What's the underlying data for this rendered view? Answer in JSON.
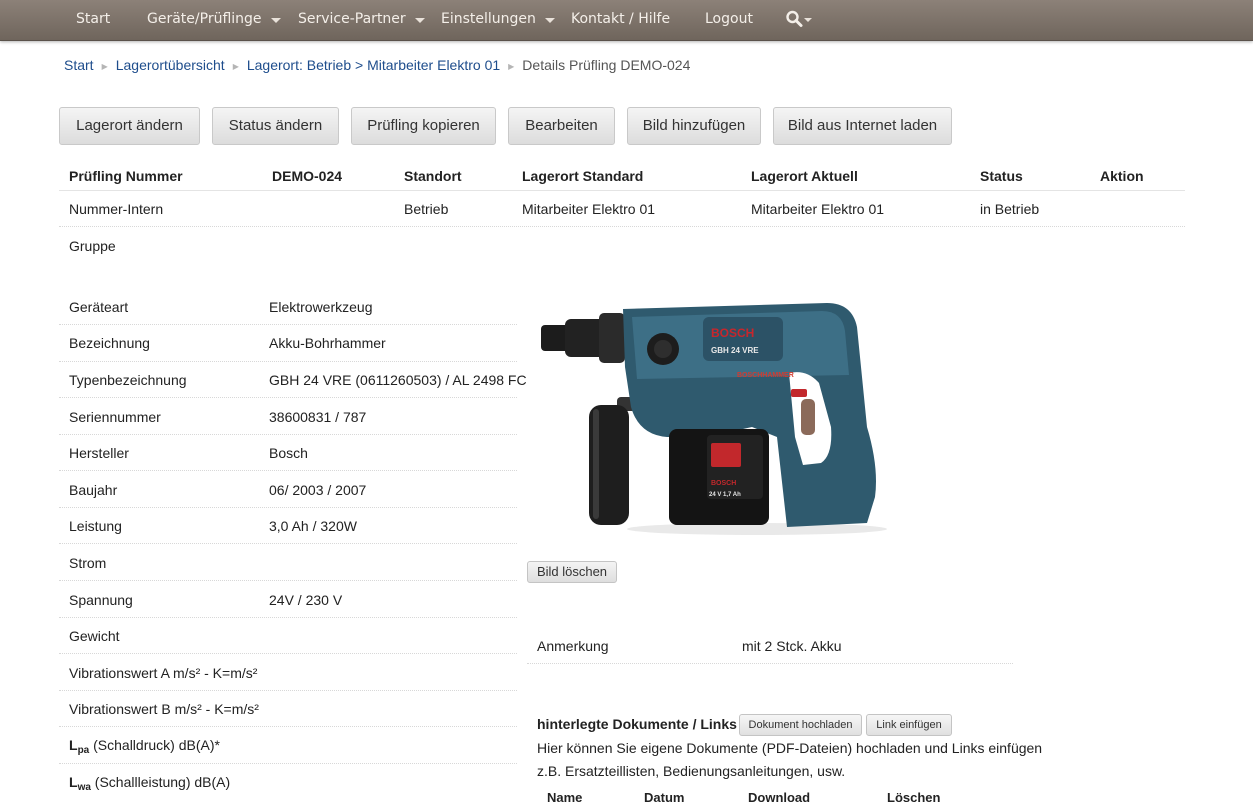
{
  "nav": {
    "start": "Start",
    "geraete": "Geräte/Prüflinge",
    "service": "Service-Partner",
    "einstellungen": "Einstellungen",
    "kontakt": "Kontakt / Hilfe",
    "logout": "Logout",
    "search_icon": "search-icon",
    "colors": {
      "bar": "#7d736a",
      "text": "#f4efe9"
    }
  },
  "breadcrumb": {
    "items": [
      "Start",
      "Lagerortübersicht",
      "Lagerort: Betrieb > Mitarbeiter Elektro 01"
    ],
    "current": "Details Prüfling DEMO-024"
  },
  "actions": {
    "lagerort": "Lagerort ändern",
    "status": "Status ändern",
    "kopieren": "Prüfling kopieren",
    "bearbeiten": "Bearbeiten",
    "bild_hinzu": "Bild hinzufügen",
    "bild_internet": "Bild aus Internet laden"
  },
  "summary": {
    "headers": {
      "nummer": "Prüfling Nummer",
      "nummer_value": "DEMO-024",
      "standort": "Standort",
      "lagerort_standard": "Lagerort Standard",
      "lagerort_aktuell": "Lagerort Aktuell",
      "status": "Status",
      "aktion": "Aktion"
    },
    "row": {
      "label": "Nummer-Intern",
      "standort": "Betrieb",
      "lagerort_standard": "Mitarbeiter Elektro 01",
      "lagerort_aktuell": "Mitarbeiter Elektro 01",
      "status": "in Betrieb"
    },
    "gruppe": "Gruppe"
  },
  "details": [
    {
      "label": "Geräteart",
      "value": "Elektrowerkzeug"
    },
    {
      "label": "Bezeichnung",
      "value": "Akku-Bohrhammer"
    },
    {
      "label": "Typenbezeichnung",
      "value": "GBH 24 VRE (0611260503) / AL 2498 FC"
    },
    {
      "label": "Seriennummer",
      "value": "38600831 / 787"
    },
    {
      "label": "Hersteller",
      "value": "Bosch"
    },
    {
      "label": "Baujahr",
      "value": "06/ 2003 / 2007"
    },
    {
      "label": "Leistung",
      "value": "3,0 Ah / 320W"
    },
    {
      "label": "Strom",
      "value": ""
    },
    {
      "label": "Spannung",
      "value": "24V / 230 V"
    },
    {
      "label": "Gewicht",
      "value": ""
    },
    {
      "label": "Vibrationswert A m/s² - K=m/s²",
      "value": ""
    },
    {
      "label": "Vibrationswert B m/s² - K=m/s²",
      "value": ""
    }
  ],
  "sound": {
    "lpa_main": "L",
    "lpa_sub": "pa",
    "lpa_rest": " (Schalldruck) dB(A)*",
    "lwa_main": "L",
    "lwa_sub": "wa",
    "lwa_rest": " (Schallleistung) dB(A)"
  },
  "image": {
    "brand": "BOSCH",
    "model": "GBH 24 VRE",
    "line": "BOSCHHAMMER",
    "battery_brand": "BOSCH",
    "battery_spec": "24 V 1,7 Ah",
    "delete_label": "Bild löschen"
  },
  "note": {
    "label": "Anmerkung",
    "value": "mit 2 Stck. Akku"
  },
  "documents": {
    "title": "hinterlegte Dokumente / Links",
    "upload": "Dokument hochladen",
    "link": "Link einfügen",
    "desc1": "Hier können Sie eigene Dokumente (PDF-Dateien) hochladen und Links einfügen",
    "desc2": "z.B. Ersatzteillisten, Bedienungsanleitungen, usw.",
    "columns": [
      "Name",
      "Datum",
      "Download",
      "Löschen"
    ]
  }
}
